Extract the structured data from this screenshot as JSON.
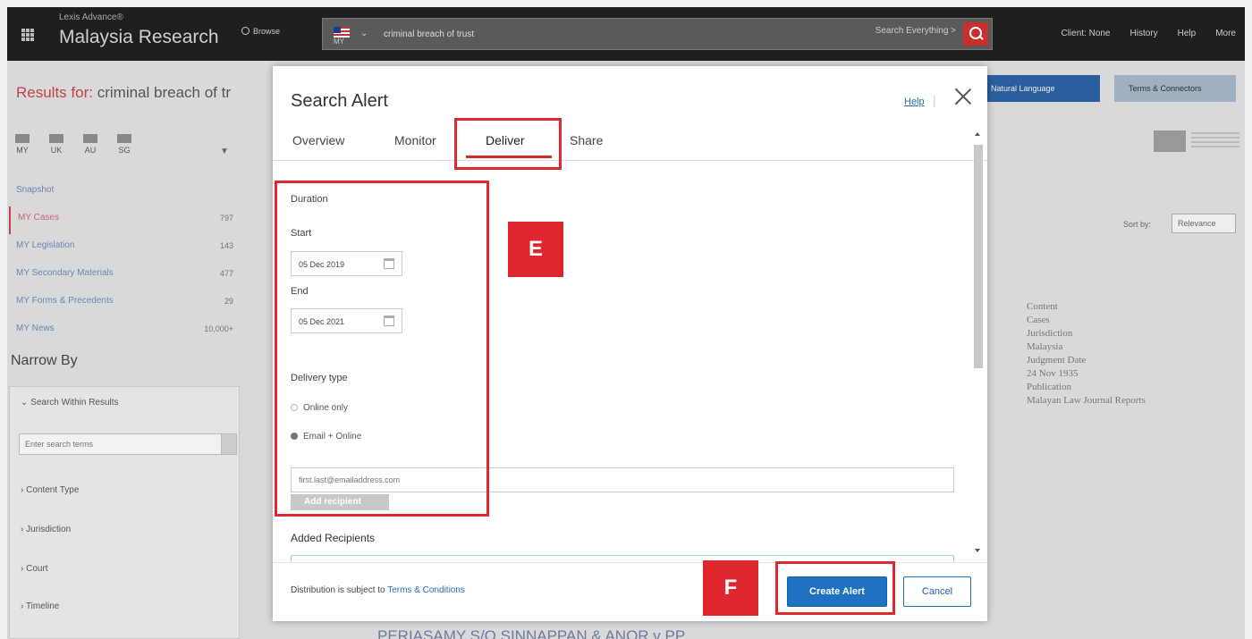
{
  "topbar": {
    "brand_small": "Lexis Advance®",
    "brand_big": "Malaysia Research",
    "browse": "Browse",
    "flag_label": "MY",
    "search_value": "criminal breach of trust",
    "search_scope": "Search Everything >",
    "links": [
      "Client: None",
      "History",
      "Help",
      "More"
    ]
  },
  "results": {
    "prefix": "Results for:",
    "query": "criminal breach of tr",
    "natural_language": "Natural Language",
    "terms_connectors": "Terms & Connectors"
  },
  "jurisdictions": [
    "MY",
    "UK",
    "AU",
    "SG"
  ],
  "categories": [
    {
      "label": "Snapshot",
      "count": ""
    },
    {
      "label": "MY Cases",
      "count": "797"
    },
    {
      "label": "MY Legislation",
      "count": "143"
    },
    {
      "label": "MY Secondary Materials",
      "count": "477"
    },
    {
      "label": "MY Forms & Precedents",
      "count": "29"
    },
    {
      "label": "MY News",
      "count": "10,000+"
    }
  ],
  "narrow": {
    "title": "Narrow By",
    "search_within": "Search Within Results",
    "search_placeholder": "Enter search terms",
    "filters": [
      "Content Type",
      "Jurisdiction",
      "Court",
      "Timeline"
    ]
  },
  "result_meta": [
    "Content",
    "Cases",
    "Jurisdiction",
    "Malaysia",
    "Judgment Date",
    "24 Nov 1935",
    "Publication",
    "Malayan Law Journal Reports"
  ],
  "sort": {
    "label": "Sort by:",
    "value": "Relevance"
  },
  "bottom_result": "PERIASAMY S/O SINNAPPAN & ANOR v PP",
  "modal": {
    "title": "Search Alert",
    "help": "Help",
    "tabs": [
      "Overview",
      "Monitor",
      "Deliver",
      "Share"
    ],
    "active_tab": "Deliver",
    "duration_label": "Duration",
    "start_label": "Start",
    "start_value": "05 Dec 2019",
    "end_label": "End",
    "end_value": "05 Dec 2021",
    "delivery_type_label": "Delivery type",
    "option_online": "Online only",
    "option_email": "Email + Online",
    "selected_delivery": "Email + Online",
    "email_placeholder": "first.last@emailaddress.com",
    "add_recipient": "Add recipient",
    "added_recipients": "Added Recipients",
    "distribution_text": "Distribution is subject to",
    "terms_link": "Terms & Conditions",
    "create_alert": "Create Alert",
    "cancel": "Cancel"
  },
  "annotations": {
    "e": "E",
    "f": "F",
    "color": "#e0272f"
  }
}
